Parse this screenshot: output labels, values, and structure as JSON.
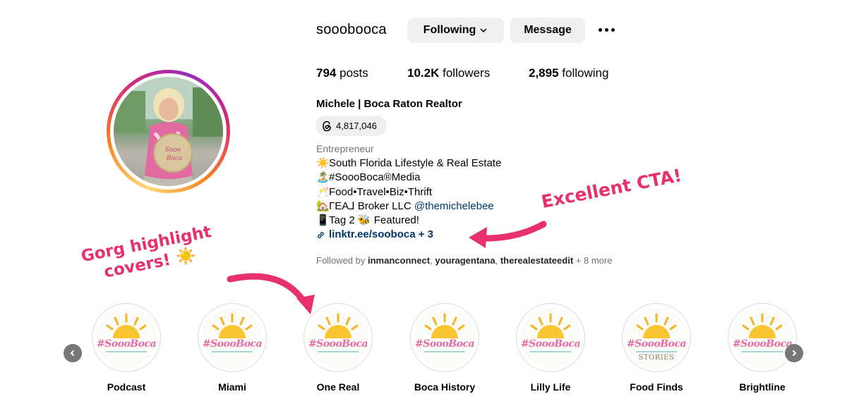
{
  "profile": {
    "username": "sooobooca",
    "following_label": "Following",
    "message_label": "Message",
    "stats": {
      "posts_count": "794",
      "posts_label": "posts",
      "followers_count": "10.2K",
      "followers_label": "followers",
      "following_count": "2,895",
      "following_label": "following"
    },
    "full_name": "Michele | Boca Raton Realtor",
    "threads_count": "4,817,046",
    "category": "Entrepreneur",
    "bio": {
      "line1_emoji": "☀️",
      "line1_text": "South Florida Lifestyle & Real Estate",
      "line2_emoji": "🏝️",
      "line2_text": "#SoooBoca®Media",
      "line3_emoji": "🥂",
      "line3_text": "Food•Travel•Biz•Thrift",
      "line4_emoji": "🏡",
      "line4_text": "ΓΕΑ⅃ Broker LLC ",
      "line4_mention": "@themichelebee",
      "line5_emoji": "📱",
      "line5_text_a": "Tag 2 ",
      "line5_bee": "🐝",
      "line5_text_b": " Featured!",
      "link": "linktr.ee/sooboca + 3"
    },
    "followed_by": {
      "prefix": "Followed by ",
      "user1": "inmanconnect",
      "sep1": ", ",
      "user2": "youragentana",
      "sep2": ", ",
      "user3": "therealestateedit",
      "suffix": " + 8 more"
    }
  },
  "annotations": {
    "cta": "Excellent CTA!",
    "highlights_line1": "Gorg highlight",
    "highlights_line2": "covers! ☀️"
  },
  "highlights": {
    "logo_text": "#SoooBoca",
    "stories_text": "STORIES",
    "items": [
      {
        "label": "Podcast"
      },
      {
        "label": "Miami"
      },
      {
        "label": "One Real"
      },
      {
        "label": "Boca History"
      },
      {
        "label": "Lilly Life"
      },
      {
        "label": "Food Finds"
      },
      {
        "label": "Brightline"
      }
    ]
  },
  "colors": {
    "annotation": "#e8306e",
    "link": "#00376b",
    "muted": "#737373"
  }
}
